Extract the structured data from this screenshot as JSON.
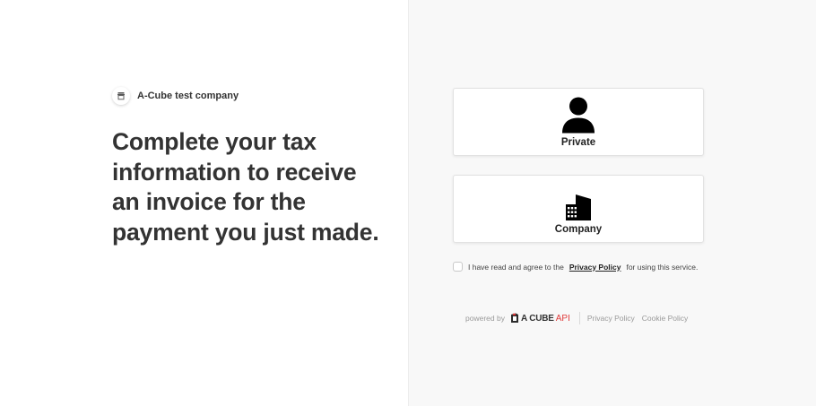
{
  "company": {
    "name": "A-Cube test company",
    "icon": "storefront-icon"
  },
  "headline": "Complete your tax information to receive an invoice for the payment you just made.",
  "options": [
    {
      "label": "Private",
      "icon": "person-icon"
    },
    {
      "label": "Company",
      "icon": "building-icon"
    }
  ],
  "consent": {
    "prefix": "I have read and agree to the",
    "link": "Privacy Policy",
    "suffix": "for using this service.",
    "checked": false
  },
  "footer": {
    "powered_by": "powered by",
    "brand": {
      "a": "A",
      "cube": "CUBE",
      "api": "API"
    },
    "links": [
      "Privacy Policy",
      "Cookie Policy"
    ]
  },
  "colors": {
    "accent_red": "#e03a3a",
    "text_dark": "#333333",
    "panel_bg": "#f8f8f8"
  }
}
